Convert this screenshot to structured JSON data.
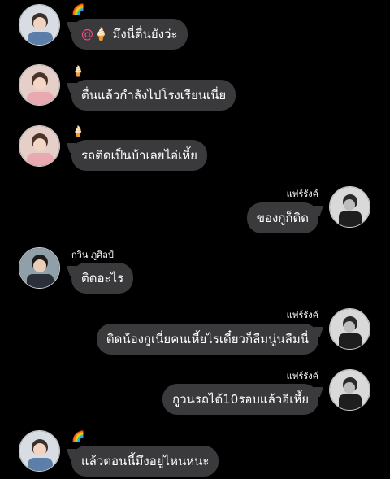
{
  "messages": [
    {
      "side": "left",
      "name": "🌈",
      "mention": "@🍦",
      "text": "มึงนี่ตื่นยังว่ะ"
    },
    {
      "side": "left",
      "name": "🍦",
      "text": "ตื่นแล้วกำลังไปโรงเรียนเนี่ย"
    },
    {
      "side": "left",
      "name": "🍦",
      "text": "รถติดเป็นบ้าเลยไอ่เหี้ย"
    },
    {
      "side": "right",
      "name": "แฟร์รังค์",
      "text": "ของกูก็ติด"
    },
    {
      "side": "left",
      "name": "กวิน ภูศิลป์",
      "text": "ติดอะไร"
    },
    {
      "side": "right",
      "name": "แฟร์รังค์",
      "text": "ติดน้องกูเนี่ยคนเหี้ยไรเดี๋ยวก็ลืมนู่นลืมนี่"
    },
    {
      "side": "right",
      "name": "แฟร์รังค์",
      "text": "กูวนรถได้10รอบแล้วอีเหี้ย"
    },
    {
      "side": "left",
      "name": "🌈",
      "text": "แล้วตอนนี้มึงอยู่ไหนหนะ"
    }
  ]
}
